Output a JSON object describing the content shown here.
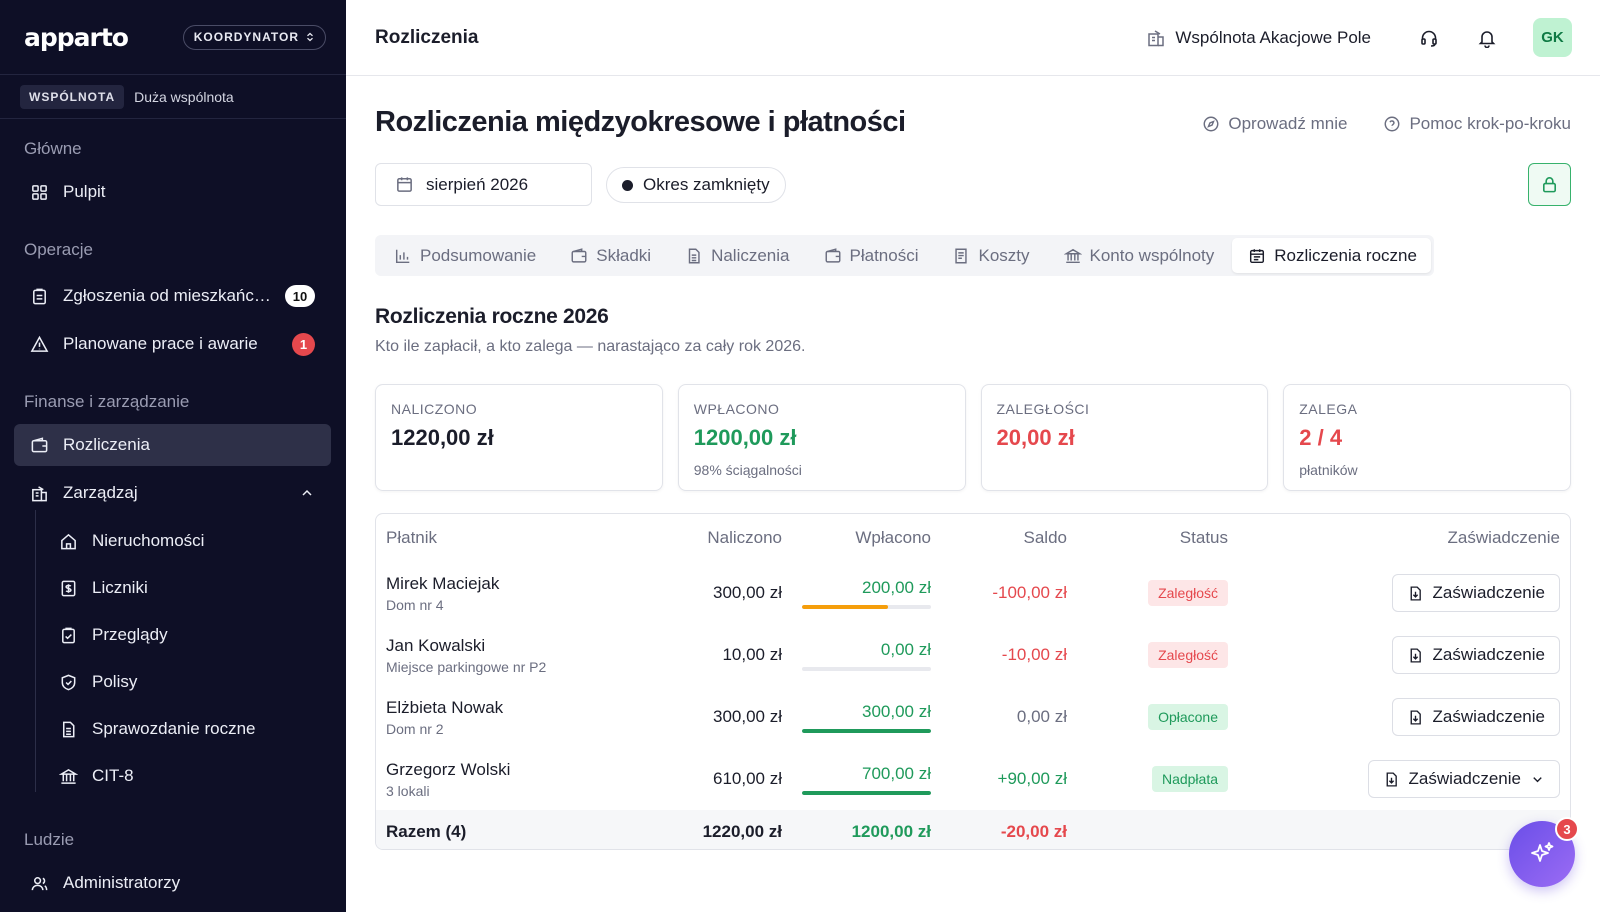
{
  "sidebar": {
    "logo": "apparto",
    "role": "KOORDYNATOR",
    "community_badge": "WSPÓLNOTA",
    "community_type": "Duża wspólnota",
    "sections": {
      "main": "Główne",
      "operations": "Operacje",
      "finance": "Finanse i zarządzanie",
      "people": "Ludzie"
    },
    "items": {
      "dashboard": "Pulpit",
      "reports": "Zgłoszenia od mieszkańców",
      "reports_count": "10",
      "planned": "Planowane prace i awarie",
      "planned_count": "1",
      "settlements": "Rozliczenia",
      "manage": "Zarządzaj",
      "properties": "Nieruchomości",
      "meters": "Liczniki",
      "inspections": "Przeglądy",
      "policies": "Polisy",
      "annual_report": "Sprawozdanie roczne",
      "cit8": "CIT-8",
      "admins": "Administratorzy"
    }
  },
  "topbar": {
    "title": "Rozliczenia",
    "community": "Wspólnota Akacjowe Pole",
    "avatar": "GK"
  },
  "page": {
    "title": "Rozliczenia międzyokresowe i płatności",
    "tour": "Oprowadź mnie",
    "help": "Pomoc krok-po-kroku",
    "period": "sierpień 2026",
    "period_status": "Okres zamknięty"
  },
  "tabs": [
    "Podsumowanie",
    "Składki",
    "Naliczenia",
    "Płatności",
    "Koszty",
    "Konto wspólnoty",
    "Rozliczenia roczne"
  ],
  "section": {
    "title": "Rozliczenia roczne 2026",
    "subtitle": "Kto ile zapłacił, a kto zalega — narastająco za cały rok 2026."
  },
  "cards": [
    {
      "label": "NALICZONO",
      "value": "1220,00 zł",
      "note": ""
    },
    {
      "label": "WPŁACONO",
      "value": "1200,00 zł",
      "note": "98% ściągalności"
    },
    {
      "label": "ZALEGŁOŚCI",
      "value": "20,00 zł",
      "note": ""
    },
    {
      "label": "ZALEGA",
      "value": "2 / 4",
      "note": "płatników"
    }
  ],
  "table": {
    "headers": [
      "Płatnik",
      "Naliczono",
      "Wpłacono",
      "Saldo",
      "Status",
      "Zaświadczenie"
    ],
    "rows": [
      {
        "name": "Mirek Maciejak",
        "unit": "Dom nr 4",
        "charged": "300,00 zł",
        "paid": "200,00 zł",
        "paid_ratio": 0.67,
        "bar_color": "#f59e0b",
        "saldo": "-100,00 zł",
        "status": "Zaległość",
        "cert": "Zaświadczenie"
      },
      {
        "name": "Jan Kowalski",
        "unit": "Miejsce parkingowe nr P2",
        "charged": "10,00 zł",
        "paid": "0,00 zł",
        "paid_ratio": 0,
        "bar_color": "#e5484d",
        "saldo": "-10,00 zł",
        "status": "Zaległość",
        "cert": "Zaświadczenie"
      },
      {
        "name": "Elżbieta Nowak",
        "unit": "Dom nr 2",
        "charged": "300,00 zł",
        "paid": "300,00 zł",
        "paid_ratio": 1,
        "bar_color": "#1f9a5b",
        "saldo": "0,00 zł",
        "status": "Opłacone",
        "cert": "Zaświadczenie"
      },
      {
        "name": "Grzegorz Wolski",
        "unit": "3 lokali",
        "charged": "610,00 zł",
        "paid": "700,00 zł",
        "paid_ratio": 1,
        "bar_color": "#1f9a5b",
        "saldo": "+90,00 zł",
        "status": "Nadpłata",
        "cert": "Zaświadczenie"
      }
    ],
    "total": {
      "label": "Razem (4)",
      "charged": "1220,00 zł",
      "paid": "1200,00 zł",
      "saldo": "-20,00 zł"
    }
  },
  "fab": {
    "badge": "3"
  },
  "colors": {
    "sidebar_bg": "#0e0f26",
    "accent_green": "#1f9a5b",
    "danger_red": "#e5484d",
    "warning_orange": "#f59e0b",
    "fab_purple": "#6a4ee8"
  }
}
